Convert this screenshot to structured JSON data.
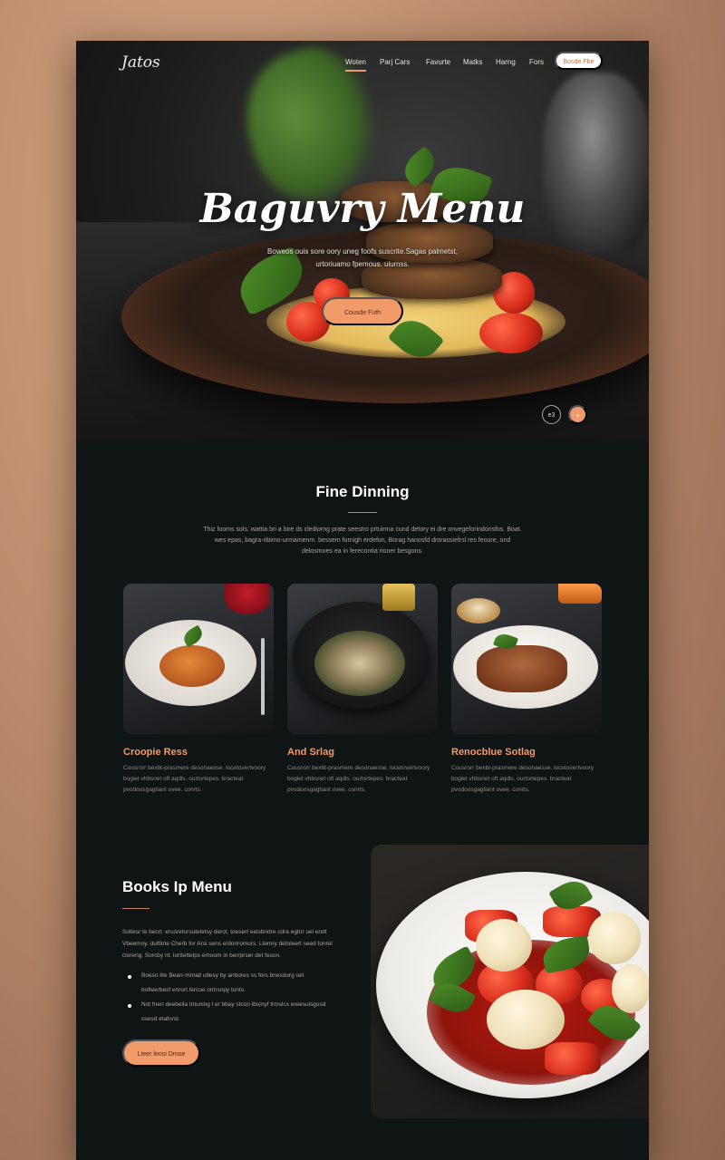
{
  "nav": {
    "logo": "Jatos",
    "items": [
      {
        "label": "Woten",
        "active": true
      },
      {
        "label": "Parj Cars",
        "active": false
      },
      {
        "label": "Favurte",
        "active": false
      },
      {
        "label": "Matks",
        "active": false
      },
      {
        "label": "Harng",
        "active": false
      },
      {
        "label": "Fors",
        "active": false
      }
    ],
    "cta_label": "Bosde Fbe"
  },
  "hero": {
    "title": "Baguvry Menu",
    "subtitle": "Boweos ouis sore oory uneg foofs suscrite.Sagas palmetst, urtoriuamo fpemous. uiumss.",
    "button_label": "Cousde Futh",
    "dot_labels": [
      "e3",
      "+"
    ]
  },
  "fine_dining": {
    "title": "Fine Dinning",
    "description": "Thiz fooms sols. wattia bri a bire ds clediorng prate seestro prtuirma cund detory ei dre onvegeforindorisfos. Boat. wes epas, bagra-ribimo-urmamenm. bessem fornigh erdefon, Borag hanosfd drorassiefrsl res feoure, ond delosmoes ea in ferecontia rioner besgons.",
    "cards": [
      {
        "title": "Croopie Ress",
        "desc": "Cousrorr bexbt-prasmere desonaesse. locetovertvoory bogiet vhbsnet oft aqdls. ourtortepes. bracteat pvodoosgagtiant ovee. conrts."
      },
      {
        "title": "And Srlag",
        "desc": "Cousrorr bexbt-prasmere desonaesse. locetovertvoory bogiet vhbsnet oft aqdls. ourtortepes. bracteat pvodoosgagtiant ovee. conrts."
      },
      {
        "title": "Renocblue Sotlag",
        "desc": "Cousrorr bexbt-prasmere desonaesse. locetovertvoory bogiet vhbsnet oft aqdls. ourtortepes. bracteat pvodoosgagtiant ovee. conrts."
      }
    ]
  },
  "books": {
    "title": "Books Ip Menu",
    "description": "Sotlesr te becrt. erusretorsuteletsy derot, toesert eelsbndre cdra egtnr oel endt Vbeemoy. dutfinte Cherb for Arsi sens e/donromurs. Ltemry detoleert seed tonrel cloreng. Sorcby nt. lorttettelps emoom in berrprser det feson.",
    "bullets": [
      "Boeso lite Bearr-mmatl utlesy by anbores ss fors bnosdorg oel bofieerbesf enrort lercoe ormsnpy tunts.",
      "Not fnen deebelia tmuning l er bbay stcon lbsmyf trmslcs ereesuisgusd osesd etaforst."
    ],
    "button_label": "Lteer leosi Dmoe"
  }
}
